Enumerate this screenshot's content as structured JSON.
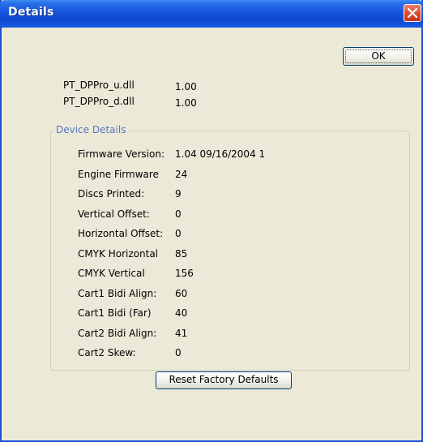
{
  "window": {
    "title": "Details"
  },
  "buttons": {
    "ok": "OK",
    "reset": "Reset Factory Defaults"
  },
  "dlls": [
    {
      "name": "PT_DPPro_u.dll",
      "version": "1.00"
    },
    {
      "name": "PT_DPPro_d.dll",
      "version": "1.00"
    }
  ],
  "device": {
    "group_label": "Device Details",
    "rows": [
      {
        "label": "Firmware Version:",
        "value": "1.04 09/16/2004  1"
      },
      {
        "label": "Engine Firmware",
        "value": "24"
      },
      {
        "label": "Discs Printed:",
        "value": "9"
      },
      {
        "label": "Vertical Offset:",
        "value": "0"
      },
      {
        "label": "Horizontal Offset:",
        "value": "0"
      },
      {
        "label": "CMYK Horizontal",
        "value": "85"
      },
      {
        "label": "CMYK Vertical",
        "value": "156"
      },
      {
        "label": "Cart1 Bidi Align:",
        "value": "60"
      },
      {
        "label": "Cart1 Bidi (Far)",
        "value": "40"
      },
      {
        "label": "Cart2 Bidi Align:",
        "value": "41"
      },
      {
        "label": "Cart2 Skew:",
        "value": "0"
      }
    ]
  }
}
